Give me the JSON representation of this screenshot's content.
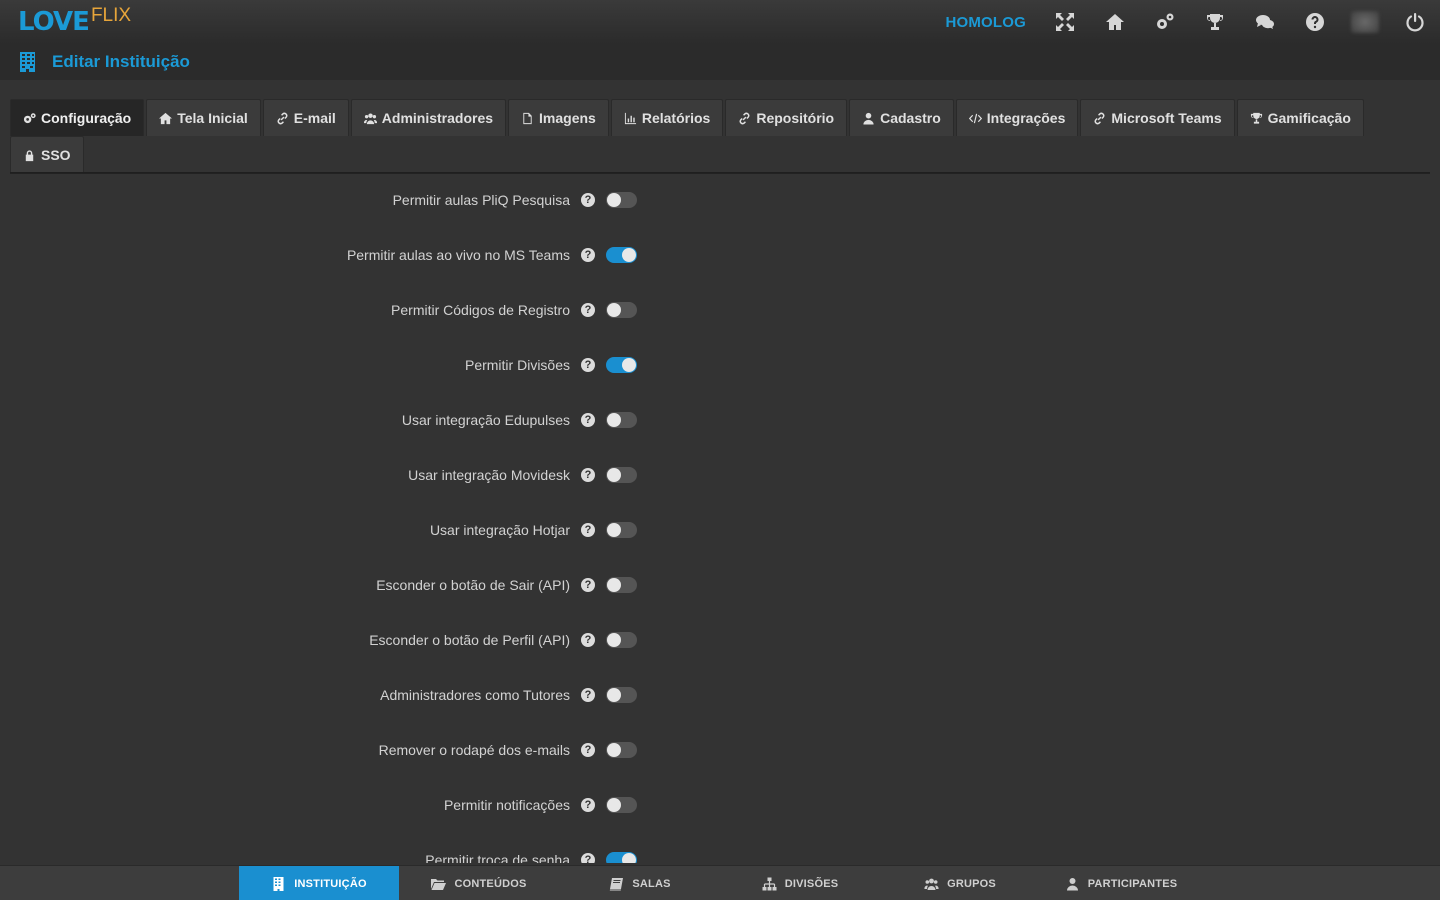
{
  "app": {
    "logo_primary": "LOVE",
    "logo_secondary": "FLIX",
    "environment": "HOMOLOG"
  },
  "topbar": {
    "icons": [
      "expand-icon",
      "home-icon",
      "gears-icon",
      "trophy-icon",
      "chat-icon",
      "help-icon",
      "avatar",
      "power-icon"
    ]
  },
  "page": {
    "title": "Editar Instituição",
    "icon": "building-icon"
  },
  "tabs": [
    {
      "label": "Configuração",
      "icon": "gears-icon",
      "active": true
    },
    {
      "label": "Tela Inicial",
      "icon": "home-icon",
      "active": false
    },
    {
      "label": "E-mail",
      "icon": "link-icon",
      "active": false
    },
    {
      "label": "Administradores",
      "icon": "users-icon",
      "active": false
    },
    {
      "label": "Imagens",
      "icon": "file-icon",
      "active": false
    },
    {
      "label": "Relatórios",
      "icon": "bar-chart-icon",
      "active": false
    },
    {
      "label": "Repositório",
      "icon": "link-icon",
      "active": false
    },
    {
      "label": "Cadastro",
      "icon": "user-icon",
      "active": false
    },
    {
      "label": "Integrações",
      "icon": "code-icon",
      "active": false
    },
    {
      "label": "Microsoft Teams",
      "icon": "link-icon",
      "active": false
    },
    {
      "label": "Gamificação",
      "icon": "trophy-icon",
      "active": false
    },
    {
      "label": "SSO",
      "icon": "lock-icon",
      "active": false
    }
  ],
  "settings": [
    {
      "label": "Permitir aulas PliQ Pesquisa",
      "enabled": false
    },
    {
      "label": "Permitir aulas ao vivo no MS Teams",
      "enabled": true
    },
    {
      "label": "Permitir Códigos de Registro",
      "enabled": false
    },
    {
      "label": "Permitir Divisões",
      "enabled": true
    },
    {
      "label": "Usar integração Edupulses",
      "enabled": false
    },
    {
      "label": "Usar integração Movidesk",
      "enabled": false
    },
    {
      "label": "Usar integração Hotjar",
      "enabled": false
    },
    {
      "label": "Esconder o botão de Sair (API)",
      "enabled": false
    },
    {
      "label": "Esconder o botão de Perfil (API)",
      "enabled": false
    },
    {
      "label": "Administradores como Tutores",
      "enabled": false
    },
    {
      "label": "Remover o rodapé dos e-mails",
      "enabled": false
    },
    {
      "label": "Permitir notificações",
      "enabled": false
    },
    {
      "label": "Permitir troca de senha",
      "enabled": true
    }
  ],
  "help_glyph": "?",
  "bottom_nav": [
    {
      "label": "INSTITUIÇÃO",
      "icon": "building-icon",
      "active": true
    },
    {
      "label": "CONTEÚDOS",
      "icon": "folder-open-icon",
      "active": false
    },
    {
      "label": "SALAS",
      "icon": "book-icon",
      "active": false
    },
    {
      "label": "DIVISÕES",
      "icon": "sitemap-icon",
      "active": false
    },
    {
      "label": "GRUPOS",
      "icon": "users-icon",
      "active": false
    },
    {
      "label": "PARTICIPANTES",
      "icon": "user-icon",
      "active": false
    }
  ],
  "colors": {
    "accent": "#1b9ad6",
    "logo_secondary": "#e7a53a",
    "background": "#333333",
    "toggle_on": "#1a8fd0",
    "toggle_off": "#555555"
  }
}
